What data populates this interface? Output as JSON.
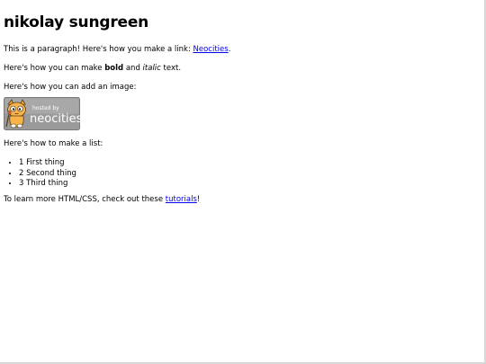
{
  "heading": "nikolay sungreen",
  "link_paragraph": {
    "prefix": "This is a paragraph! Here's how you make a link: ",
    "link_text": "Neocities",
    "suffix": "."
  },
  "format_paragraph": {
    "prefix": "Here's how you can make ",
    "bold_text": "bold",
    "middle": " and ",
    "italic_text": "italic",
    "suffix": " text."
  },
  "image_paragraph": "Here's how you can add an image:",
  "badge": {
    "small_text": "hosted by",
    "big_text": "neocities",
    "icon": "neocities-cat-mascot",
    "background_color": "#9a9a9a"
  },
  "list_intro": "Here's how to make a list:",
  "list_items": [
    "1 First thing",
    "2 Second thing",
    "3 Third thing"
  ],
  "learn_paragraph": {
    "prefix": "To learn more HTML/CSS, check out these ",
    "link_text": "tutorials",
    "suffix": "!"
  }
}
